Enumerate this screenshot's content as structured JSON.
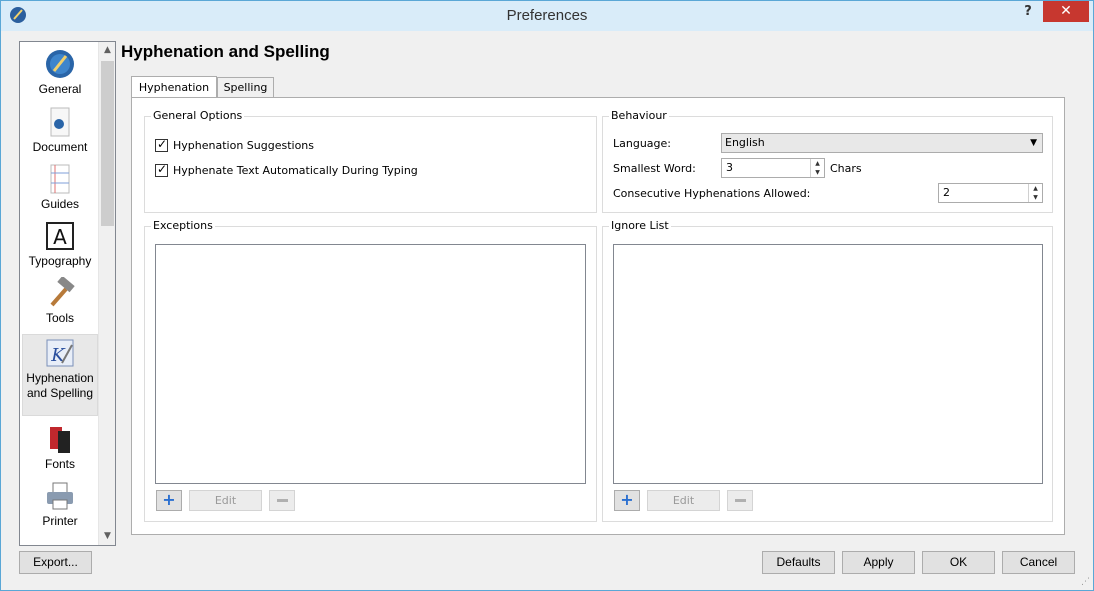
{
  "window": {
    "title": "Preferences",
    "help": "?",
    "close": "✕"
  },
  "sidebar": {
    "items": [
      {
        "label": "General",
        "icon": "general-icon"
      },
      {
        "label": "Document",
        "icon": "document-icon"
      },
      {
        "label": "Guides",
        "icon": "guides-icon"
      },
      {
        "label": "Typography",
        "icon": "typography-icon"
      },
      {
        "label": "Tools",
        "icon": "tools-icon"
      },
      {
        "label": "Hyphenation",
        "label2": "and Spelling",
        "icon": "hyphenation-icon",
        "active": true
      },
      {
        "label": "Fonts",
        "icon": "fonts-icon"
      },
      {
        "label": "Printer",
        "icon": "printer-icon"
      }
    ]
  },
  "page": {
    "title": "Hyphenation and Spelling"
  },
  "tabs": [
    {
      "label": "Hyphenation",
      "active": true
    },
    {
      "label": "Spelling",
      "active": false
    }
  ],
  "general_options": {
    "title": "General Options",
    "options": [
      {
        "label": "Hyphenation Suggestions",
        "checked": true
      },
      {
        "label": "Hyphenate Text Automatically During Typing",
        "checked": true
      }
    ]
  },
  "behaviour": {
    "title": "Behaviour",
    "language_label": "Language:",
    "language_value": "English",
    "smallest_word_label": "Smallest Word:",
    "smallest_word_value": "3",
    "smallest_word_unit": "Chars",
    "consecutive_label": "Consecutive Hyphenations Allowed:",
    "consecutive_value": "2"
  },
  "exceptions": {
    "title": "Exceptions",
    "add": "+",
    "edit": "Edit"
  },
  "ignore_list": {
    "title": "Ignore List",
    "add": "+",
    "edit": "Edit"
  },
  "footer": {
    "export": "Export...",
    "defaults": "Defaults",
    "apply": "Apply",
    "ok": "OK",
    "cancel": "Cancel"
  }
}
